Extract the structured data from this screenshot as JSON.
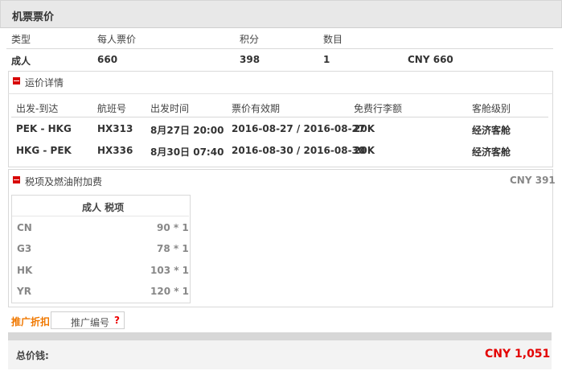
{
  "header": {
    "title": "机票票价"
  },
  "summary": {
    "headers": [
      "类型",
      "每人票价",
      "积分",
      "数目"
    ],
    "row": {
      "type": "成人",
      "price": "660",
      "points": "398",
      "count": "1",
      "total": "CNY 660"
    }
  },
  "fare": {
    "title": "运价详情",
    "headers": [
      "出发-到达",
      "航班号",
      "出发时间",
      "票价有效期",
      "免费行李额",
      "客舱级别"
    ],
    "rows": [
      {
        "route": "PEK - HKG",
        "flight": "HX313",
        "time": "8月27日 20:00",
        "validity": "2016-08-27 / 2016-08-27",
        "baggage": "20K",
        "cabin": "经济客舱"
      },
      {
        "route": "HKG - PEK",
        "flight": "HX336",
        "time": "8月30日 07:40",
        "validity": "2016-08-30 / 2016-08-30",
        "baggage": "20K",
        "cabin": "经济客舱"
      }
    ]
  },
  "tax": {
    "title": "税项及燃油附加费",
    "total": "CNY 391",
    "table_header": "成人 税项",
    "rows": [
      {
        "code": "CN",
        "amount": "90 * 1"
      },
      {
        "code": "G3",
        "amount": "78 * 1"
      },
      {
        "code": "HK",
        "amount": "103 * 1"
      },
      {
        "code": "YR",
        "amount": "120 * 1"
      }
    ]
  },
  "promo": {
    "label": "推广折扣",
    "placeholder": "推广编号",
    "help": "?"
  },
  "total": {
    "label": "总价钱:",
    "value": "CNY 1,051"
  },
  "colors": {
    "accent_red": "#e30000",
    "promo_orange": "#f07800",
    "header_bg": "#e8e8e8"
  }
}
